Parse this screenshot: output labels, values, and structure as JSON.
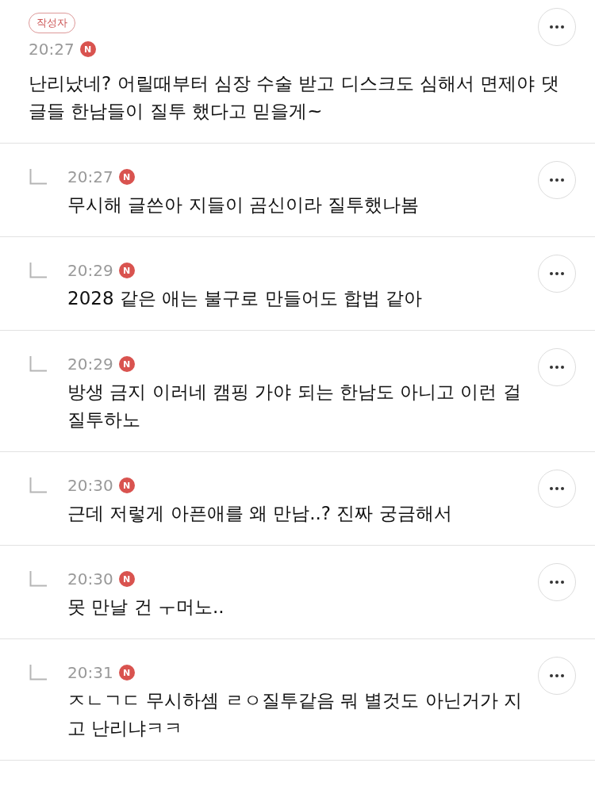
{
  "comments": [
    {
      "kind": "post",
      "author_badge": "작성자",
      "time": "20:27",
      "new_badge": "N",
      "text": "난리났네? 어릴때부터 심장 수술 받고 디스크도 심해서 면제야 댓글들 한남들이 질투 했다고 믿을게~"
    },
    {
      "kind": "reply",
      "time": "20:27",
      "new_badge": "N",
      "text": "무시해 글쓴아 지들이 곰신이라 질투했나봄"
    },
    {
      "kind": "reply",
      "time": "20:29",
      "new_badge": "N",
      "text": "2028 같은 애는 불구로 만들어도 합법 같아"
    },
    {
      "kind": "reply",
      "time": "20:29",
      "new_badge": "N",
      "text": "방생 금지 이러네 캠핑 가야 되는 한남도 아니고 이런 걸 질투하노"
    },
    {
      "kind": "reply",
      "time": "20:30",
      "new_badge": "N",
      "text": "근데 저렇게 아픈애를 왜 만남..? 진짜 궁금해서"
    },
    {
      "kind": "reply",
      "time": "20:30",
      "new_badge": "N",
      "text": "못 만날 건 ㅜ머노.."
    },
    {
      "kind": "reply",
      "time": "20:31",
      "new_badge": "N",
      "text": "ㅈㄴㄱㄷ 무시하셈 ㄹㅇ질투같음 뭐 별것도 아닌거가 지고 난리냐ㅋㅋ"
    }
  ]
}
